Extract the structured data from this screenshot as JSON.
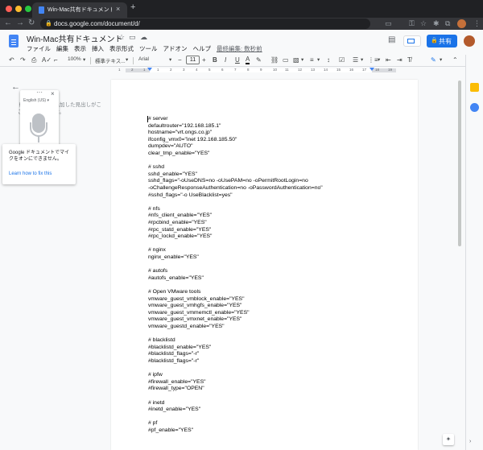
{
  "browser": {
    "tab_title": "Win-Mac共有ドキュメント - Goo",
    "tab_close": "×",
    "new_tab": "+",
    "url": "docs.google.com/document/d/",
    "nav": {
      "back": "←",
      "forward": "→",
      "reload": "↻"
    }
  },
  "docs": {
    "title": "Win-Mac共有ドキュメント",
    "menu": [
      "ファイル",
      "編集",
      "表示",
      "挿入",
      "表示形式",
      "ツール",
      "アドオン",
      "ヘルプ"
    ],
    "last_edit": "最終編集: 数秒前",
    "share_label": "共有"
  },
  "toolbar": {
    "zoom": "100%",
    "style": "標準テキス...",
    "font": "Arial",
    "font_size": "11",
    "bold": "B",
    "italic": "I",
    "underline": "U",
    "text_color": "A"
  },
  "ruler": {
    "numbers": [
      "1",
      "2",
      "1",
      "1",
      "2",
      "3",
      "4",
      "5",
      "6",
      "7",
      "8",
      "9",
      "10",
      "11",
      "12",
      "13",
      "14",
      "15",
      "16",
      "17",
      "18",
      "19"
    ]
  },
  "outline": {
    "hint": "ドキュメントに追加した見出しがここに表示されます。"
  },
  "voice": {
    "language": "English (US)",
    "menu_dots": "···",
    "close": "×",
    "warning": "Google ドキュメントでマイクをオンにできません。",
    "link": "Learn how to fix this"
  },
  "document": {
    "lines": [
      "# server",
      "defaultrouter=\"192.168.185.1\"",
      "hostname=\"vrt.ongs.co.jp\"",
      "ifconfig_vmx0=\"inet 192.168.185.50\"",
      "dumpdev=\"AUTO\"",
      "clear_tmp_enable=\"YES\"",
      "",
      "# sshd",
      "sshd_enable=\"YES\"",
      "sshd_flags=\"-oUseDNS=no -oUsePAM=no -oPermitRootLogin=no",
      "-oChallengeResponseAuthentication=no -oPasswordAuthentication=no\"",
      "#sshd_flags=\"-o UseBlacklist=yes\"",
      "",
      "# nfs",
      "#nfs_client_enable=\"YES\"",
      "#rpcbind_enable=\"YES\"",
      "#rpc_statd_enable=\"YES\"",
      "#rpc_lockd_enable=\"YES\"",
      "",
      "# nginx",
      "nginx_enable=\"YES\"",
      "",
      "# autofs",
      "#autofs_enable=\"YES\"",
      "",
      "# Open VMware tools",
      "vmware_guest_vmblock_enable=\"YES\"",
      "vmware_guest_vmhgfs_enable=\"YES\"",
      "vmware_guest_vmmemctl_enable=\"YES\"",
      "vmware_guest_vmxnet_enable=\"YES\"",
      "vmware_guestd_enable=\"YES\"",
      "",
      "# blacklistd",
      "#blacklistd_enable=\"YES\"",
      "#blacklistd_flags=\"-r\"",
      "#blacklistd_flags=\"-r\"",
      "",
      "# ipfw",
      "#firewall_enable=\"YES\"",
      "#firewall_type=\"OPEN\"",
      "",
      "# inetd",
      "#inetd_enable=\"YES\"",
      "",
      "# pf",
      "#pf_enable=\"YES\""
    ]
  },
  "colors": {
    "accent": "#1a73e8",
    "docs_blue": "#4285f4",
    "chrome_dark": "#202124"
  }
}
